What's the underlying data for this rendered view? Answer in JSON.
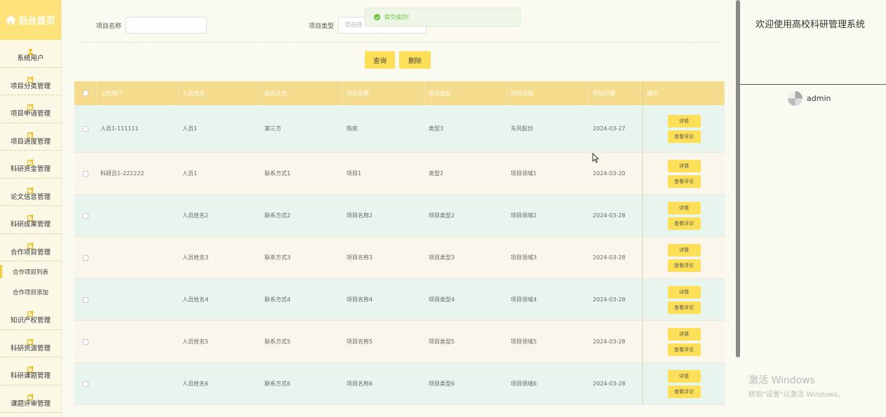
{
  "sidebar": {
    "brand": "后台首页",
    "items": [
      {
        "label": "系统用户",
        "icon": "user-icon"
      },
      {
        "label": "项目分类管理",
        "icon": "edit-icon"
      },
      {
        "label": "项目申请管理",
        "icon": "edit-icon"
      },
      {
        "label": "项目进度管理",
        "icon": "edit-icon"
      },
      {
        "label": "科研资金管理",
        "icon": "edit-icon"
      },
      {
        "label": "论文信息管理",
        "icon": "edit-icon"
      },
      {
        "label": "科研成果管理",
        "icon": "edit-icon"
      },
      {
        "label": "合作项目管理",
        "icon": "edit-icon"
      }
    ],
    "sub_items": [
      {
        "label": "合作项目列表",
        "active": true
      },
      {
        "label": "合作项目添加",
        "active": false
      }
    ],
    "items_after": [
      {
        "label": "知识产权管理",
        "icon": "edit-icon"
      },
      {
        "label": "科研资源管理",
        "icon": "edit-icon"
      },
      {
        "label": "科研课题管理",
        "icon": "edit-icon"
      },
      {
        "label": "课题评审管理",
        "icon": "edit-icon"
      }
    ]
  },
  "search": {
    "name_label": "项目名称",
    "name_value": "",
    "type_label": "项目类型",
    "type_placeholder": "请选择"
  },
  "toast": {
    "text": "提交成功!"
  },
  "actions": {
    "query": "查询",
    "delete": "删除"
  },
  "table": {
    "headers": [
      "上传用户",
      "人员姓名",
      "联系方式",
      "项目名称",
      "项目类型",
      "项目领域",
      "开始日期",
      "操作"
    ],
    "rows": [
      {
        "user": "人员1-111111",
        "name": "人员1",
        "contact": "第三方",
        "project": "购房",
        "type": "类型3",
        "field": "东风股份",
        "date": "2024-03-27"
      },
      {
        "user": "科研员1-222222",
        "name": "人员1",
        "contact": "联系方式1",
        "project": "项目1",
        "type": "类型2",
        "field": "项目领域1",
        "date": "2024-03-20"
      },
      {
        "user": "",
        "name": "人员姓名2",
        "contact": "联系方式2",
        "project": "项目名称2",
        "type": "项目类型2",
        "field": "项目领域2",
        "date": "2024-03-28"
      },
      {
        "user": "",
        "name": "人员姓名3",
        "contact": "联系方式3",
        "project": "项目名称3",
        "type": "项目类型3",
        "field": "项目领域3",
        "date": "2024-03-28"
      },
      {
        "user": "",
        "name": "人员姓名4",
        "contact": "联系方式4",
        "project": "项目名称4",
        "type": "项目类型4",
        "field": "项目领域4",
        "date": "2024-03-28"
      },
      {
        "user": "",
        "name": "人员姓名5",
        "contact": "联系方式5",
        "project": "项目名称5",
        "type": "项目类型5",
        "field": "项目领域5",
        "date": "2024-03-28"
      },
      {
        "user": "",
        "name": "人员姓名6",
        "contact": "联系方式6",
        "project": "项目名称6",
        "type": "项目类型6",
        "field": "项目领域6",
        "date": "2024-03-28"
      }
    ],
    "detail_label": "详情",
    "review_label": "查看评论"
  },
  "right_panel": {
    "welcome": "欢迎使用高校科研管理系统",
    "username": "admin"
  },
  "watermark": {
    "line1": "激活 Windows",
    "line2": "转到\"设置\"以激活 Windows。"
  },
  "colors": {
    "accent": "#fde057",
    "header": "#f5dc8c",
    "row_green": "#e8f5ee",
    "row_cream": "#fbf6eb",
    "success": "#67c23a"
  }
}
